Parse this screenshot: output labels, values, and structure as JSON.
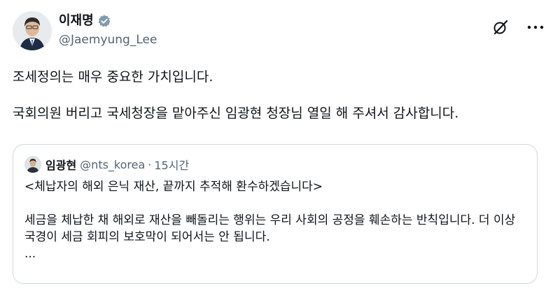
{
  "author": {
    "name": "이재명",
    "handle": "@Jaemyung_Lee",
    "verified_color": "#829aab"
  },
  "tweet": {
    "paragraphs": [
      "조세정의는 매우 중요한 가치입니다.",
      "국회의원 버리고 국세청장을 맡아주신 임광현 청장님 열일 해 주셔서 감사합니다."
    ]
  },
  "quote": {
    "name": "임광현",
    "handle": "@nts_korea",
    "separator": "·",
    "time": "15시간",
    "line1": "<체납자의 해외 은닉 재산, 끝까지 추적해 환수하겠습니다>",
    "line2": "세금을 체납한 채 해외로 재산을 빼돌리는 행위는 우리 사회의 공정을 훼손하는 반칙입니다. 더 이상 국경이 세금 회피의 보호막이 되어서는 안 됩니다.",
    "ellipsis": "..."
  },
  "icons": {
    "header_actions": [
      "grok-icon",
      "more-icon"
    ]
  }
}
